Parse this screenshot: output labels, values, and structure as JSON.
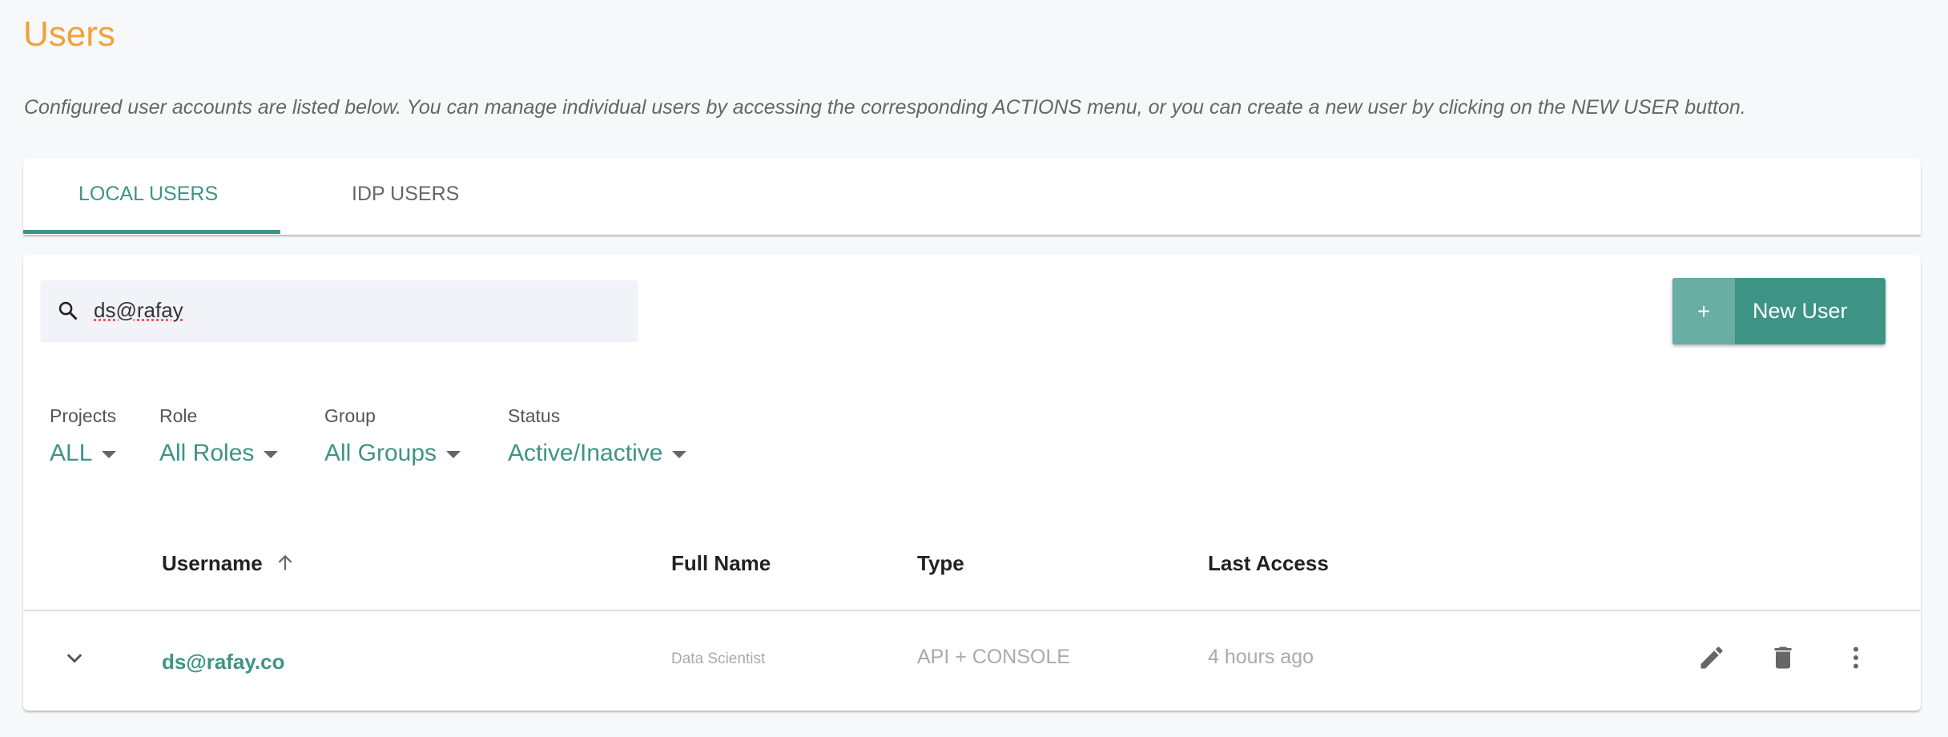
{
  "page": {
    "title": "Users",
    "description": "Configured user accounts are listed below. You can manage individual users by accessing the corresponding ACTIONS menu, or you can create a new user by clicking on the NEW USER button."
  },
  "tabs": [
    {
      "label": "LOCAL USERS",
      "active": true
    },
    {
      "label": "IDP USERS",
      "active": false
    }
  ],
  "search": {
    "value": "ds@rafay",
    "icon": "search-icon"
  },
  "new_user_button": {
    "plus": "+",
    "label": "New User"
  },
  "filters": [
    {
      "label": "Projects",
      "value": "ALL"
    },
    {
      "label": "Role",
      "value": "All Roles"
    },
    {
      "label": "Group",
      "value": "All Groups"
    },
    {
      "label": "Status",
      "value": "Active/Inactive"
    }
  ],
  "table": {
    "columns": [
      "Username",
      "Full Name",
      "Type",
      "Last Access"
    ],
    "sort": {
      "column": "Username",
      "direction": "ascending"
    },
    "rows": [
      {
        "username": "ds@rafay.co",
        "full_name": "Data Scientist",
        "type": "API + CONSOLE",
        "last_access": "4 hours ago"
      }
    ]
  },
  "colors": {
    "accent": "#3d9485",
    "title": "#f0a23b"
  }
}
